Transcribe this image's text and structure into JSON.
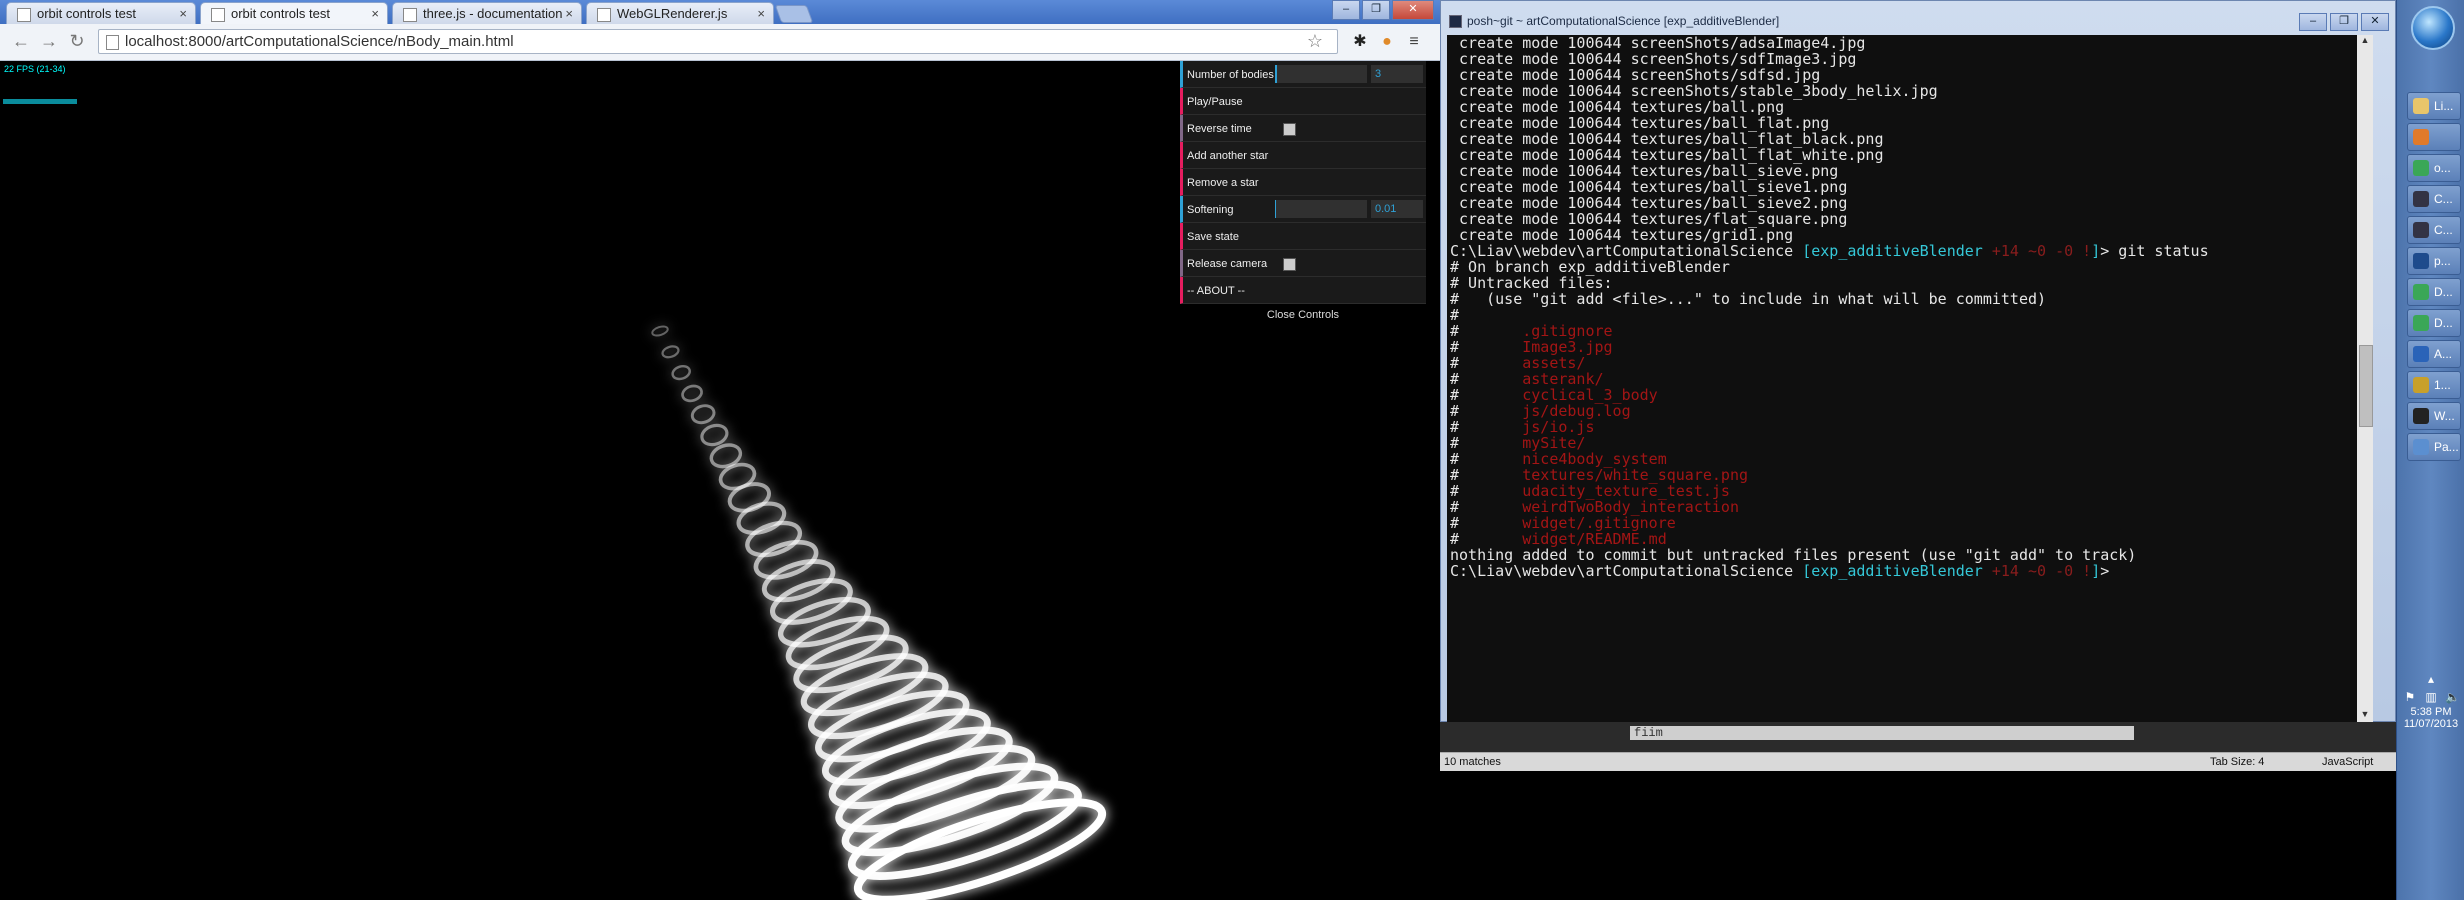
{
  "browser": {
    "tabs": [
      {
        "label": "orbit controls test",
        "active": false
      },
      {
        "label": "orbit controls test",
        "active": true
      },
      {
        "label": "three.js - documentation",
        "active": false
      },
      {
        "label": "WebGLRenderer.js",
        "active": false
      }
    ],
    "tab_close_glyph": "×",
    "url": "localhost:8000/artComputationalScience/nBody_main.html"
  },
  "scene": {
    "fps_label": "22 FPS (21-34)"
  },
  "gui": {
    "rows": [
      {
        "label": "Number of bodies",
        "kind": "number",
        "value": "3"
      },
      {
        "label": "Play/Pause",
        "kind": "function"
      },
      {
        "label": "Reverse time",
        "kind": "boolean"
      },
      {
        "label": "Add another star",
        "kind": "function"
      },
      {
        "label": "Remove a star",
        "kind": "function"
      },
      {
        "label": "Softening",
        "kind": "number",
        "value": "0.01"
      },
      {
        "label": "Save state",
        "kind": "function"
      },
      {
        "label": "Release camera",
        "kind": "boolean"
      },
      {
        "label": "-- ABOUT --",
        "kind": "function"
      }
    ],
    "close_label": "Close Controls"
  },
  "console": {
    "title": "posh~git ~ artComputationalScience [exp_additiveBlender]",
    "lines": [
      {
        "segments": [
          {
            "t": " create mode 100644 screenShots/adsaImage4.jpg",
            "c": "plain"
          }
        ]
      },
      {
        "segments": [
          {
            "t": " create mode 100644 screenShots/sdfImage3.jpg",
            "c": "plain"
          }
        ]
      },
      {
        "segments": [
          {
            "t": " create mode 100644 screenShots/sdfsd.jpg",
            "c": "plain"
          }
        ]
      },
      {
        "segments": [
          {
            "t": " create mode 100644 screenShots/stable_3body_helix.jpg",
            "c": "plain"
          }
        ]
      },
      {
        "segments": [
          {
            "t": " create mode 100644 textures/ball.png",
            "c": "plain"
          }
        ]
      },
      {
        "segments": [
          {
            "t": " create mode 100644 textures/ball_flat.png",
            "c": "plain"
          }
        ]
      },
      {
        "segments": [
          {
            "t": " create mode 100644 textures/ball_flat_black.png",
            "c": "plain"
          }
        ]
      },
      {
        "segments": [
          {
            "t": " create mode 100644 textures/ball_flat_white.png",
            "c": "plain"
          }
        ]
      },
      {
        "segments": [
          {
            "t": " create mode 100644 textures/ball_sieve.png",
            "c": "plain"
          }
        ]
      },
      {
        "segments": [
          {
            "t": " create mode 100644 textures/ball_sieve1.png",
            "c": "plain"
          }
        ]
      },
      {
        "segments": [
          {
            "t": " create mode 100644 textures/ball_sieve2.png",
            "c": "plain"
          }
        ]
      },
      {
        "segments": [
          {
            "t": " create mode 100644 textures/flat_square.png",
            "c": "plain"
          }
        ]
      },
      {
        "segments": [
          {
            "t": " create mode 100644 textures/grid1.png",
            "c": "plain"
          }
        ]
      },
      {
        "segments": [
          {
            "t": "C:\\Liav\\webdev\\artComputationalScience ",
            "c": "plain"
          },
          {
            "t": "[exp_additiveBlender",
            "c": "branch"
          },
          {
            "t": " +14 ~0 -0 !",
            "c": "stat"
          },
          {
            "t": "]",
            "c": "branch"
          },
          {
            "t": "> git status",
            "c": "plain"
          }
        ]
      },
      {
        "segments": [
          {
            "t": "# On branch exp_additiveBlender",
            "c": "plain"
          }
        ]
      },
      {
        "segments": [
          {
            "t": "# Untracked files:",
            "c": "plain"
          }
        ]
      },
      {
        "segments": [
          {
            "t": "#   (use \"git add <file>...\" to include in what will be committed)",
            "c": "plain"
          }
        ]
      },
      {
        "segments": [
          {
            "t": "#",
            "c": "plain"
          }
        ]
      },
      {
        "segments": [
          {
            "t": "#       ",
            "c": "plain"
          },
          {
            "t": ".gitignore",
            "c": "red"
          }
        ]
      },
      {
        "segments": [
          {
            "t": "#       ",
            "c": "plain"
          },
          {
            "t": "Image3.jpg",
            "c": "red"
          }
        ]
      },
      {
        "segments": [
          {
            "t": "#       ",
            "c": "plain"
          },
          {
            "t": "assets/",
            "c": "red"
          }
        ]
      },
      {
        "segments": [
          {
            "t": "#       ",
            "c": "plain"
          },
          {
            "t": "asterank/",
            "c": "red"
          }
        ]
      },
      {
        "segments": [
          {
            "t": "#       ",
            "c": "plain"
          },
          {
            "t": "cyclical_3_body",
            "c": "red"
          }
        ]
      },
      {
        "segments": [
          {
            "t": "#       ",
            "c": "plain"
          },
          {
            "t": "js/debug.log",
            "c": "red"
          }
        ]
      },
      {
        "segments": [
          {
            "t": "#       ",
            "c": "plain"
          },
          {
            "t": "js/io.js",
            "c": "red"
          }
        ]
      },
      {
        "segments": [
          {
            "t": "#       ",
            "c": "plain"
          },
          {
            "t": "mySite/",
            "c": "red"
          }
        ]
      },
      {
        "segments": [
          {
            "t": "#       ",
            "c": "plain"
          },
          {
            "t": "nice4body_system",
            "c": "red"
          }
        ]
      },
      {
        "segments": [
          {
            "t": "#       ",
            "c": "plain"
          },
          {
            "t": "textures/white_square.png",
            "c": "red"
          }
        ]
      },
      {
        "segments": [
          {
            "t": "#       ",
            "c": "plain"
          },
          {
            "t": "udacity_texture_test.js",
            "c": "red"
          }
        ]
      },
      {
        "segments": [
          {
            "t": "#       ",
            "c": "plain"
          },
          {
            "t": "weirdTwoBody_interaction",
            "c": "red"
          }
        ]
      },
      {
        "segments": [
          {
            "t": "#       ",
            "c": "plain"
          },
          {
            "t": "widget/.gitignore",
            "c": "red"
          }
        ]
      },
      {
        "segments": [
          {
            "t": "#       ",
            "c": "plain"
          },
          {
            "t": "widget/README.md",
            "c": "red"
          }
        ]
      },
      {
        "segments": [
          {
            "t": "nothing added to commit but untracked files present (use \"git add\" to track)",
            "c": "plain"
          }
        ]
      },
      {
        "segments": [
          {
            "t": "C:\\Liav\\webdev\\artComputationalScience ",
            "c": "plain"
          },
          {
            "t": "[exp_additiveBlender",
            "c": "branch"
          },
          {
            "t": " +14 ~0 -0 !",
            "c": "stat"
          },
          {
            "t": "]",
            "c": "branch"
          },
          {
            "t": ">",
            "c": "plain"
          }
        ]
      }
    ]
  },
  "editor": {
    "find_text": "fiim",
    "status_matches": "10 matches",
    "status_tabsize": "Tab Size: 4",
    "status_language": "JavaScript"
  },
  "taskbar": {
    "items": [
      {
        "label": "Li...",
        "icon": "folder-icon",
        "color": "#e8c56a"
      },
      {
        "label": "",
        "icon": "firefox-icon",
        "color": "#e07a2a"
      },
      {
        "label": "o...",
        "icon": "chrome-icon",
        "color": "#3aa757"
      },
      {
        "label": "C...",
        "icon": "terminal-icon",
        "color": "#334"
      },
      {
        "label": "C...",
        "icon": "terminal-icon",
        "color": "#334"
      },
      {
        "label": "p...",
        "icon": "powershell-icon",
        "color": "#1e4b8c"
      },
      {
        "label": "D...",
        "icon": "chrome-icon",
        "color": "#3aa757"
      },
      {
        "label": "D...",
        "icon": "chrome-icon",
        "color": "#3aa757"
      },
      {
        "label": "A...",
        "icon": "app-icon",
        "color": "#2a63b8"
      },
      {
        "label": "1...",
        "icon": "tool-icon",
        "color": "#c8a02a"
      },
      {
        "label": "W...",
        "icon": "cmd-icon",
        "color": "#222"
      },
      {
        "label": "Pa...",
        "icon": "paint-icon",
        "color": "#5b8fd0"
      }
    ],
    "clock_time": "5:38 PM",
    "clock_date": "11/07/2013"
  },
  "colors": {
    "console_branch": "#35c8d8",
    "console_red": "#a31515",
    "gui_number_accent": "#2fa1d6",
    "gui_function_accent": "#e61d5f"
  }
}
